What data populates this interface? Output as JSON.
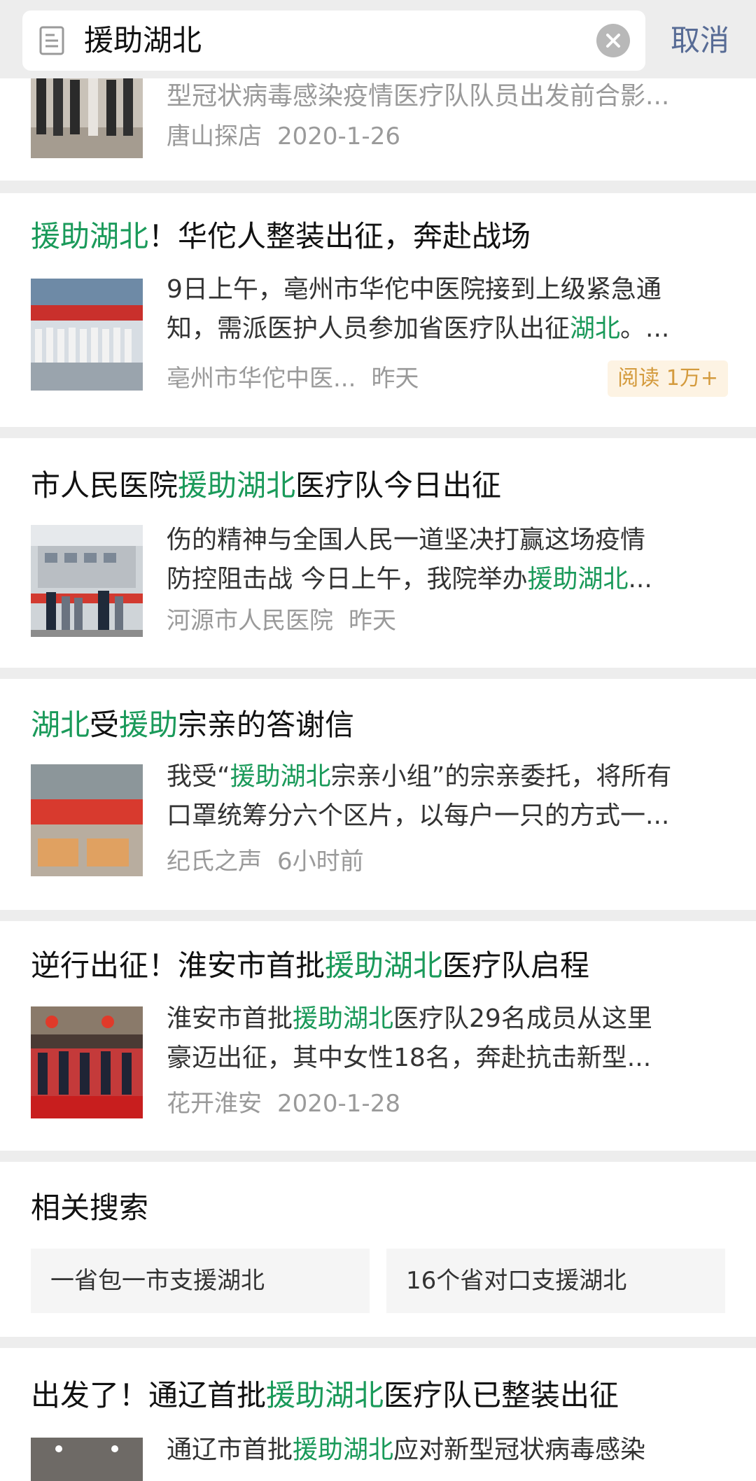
{
  "search": {
    "query": "援助湖北",
    "cancel_label": "取消"
  },
  "results": [
    {
      "snippet_lines": [
        "型冠状病毒感染疫情医疗队队员出发前合影..."
      ],
      "source": "唐山探店",
      "date": "2020-1-26"
    },
    {
      "title": [
        {
          "t": "援助湖北",
          "h": true
        },
        {
          "t": "！华佗人整装出征，奔赴战场",
          "h": false
        }
      ],
      "snippet_lines": [
        [
          {
            "t": "9日上午，亳州市华佗中医院接到上级紧急通",
            "h": false
          }
        ],
        [
          {
            "t": "知，需派医护人员参加省医疗队出征",
            "h": false
          },
          {
            "t": "湖北",
            "h": true
          },
          {
            "t": "。...",
            "h": false
          }
        ]
      ],
      "source": "亳州市华佗中医...",
      "date": "昨天",
      "read_count": "阅读 1万+"
    },
    {
      "title": [
        {
          "t": "市人民医院",
          "h": false
        },
        {
          "t": "援助湖北",
          "h": true
        },
        {
          "t": "医疗队今日出征",
          "h": false
        }
      ],
      "snippet_lines": [
        [
          {
            "t": "伤的精神与全国人民一道坚决打赢这场疫情",
            "h": false
          }
        ],
        [
          {
            "t": "防控阻击战 今日上午，我院举办",
            "h": false
          },
          {
            "t": "援助湖北",
            "h": true
          },
          {
            "t": "...",
            "h": false
          }
        ]
      ],
      "source": "河源市人民医院",
      "date": "昨天"
    },
    {
      "title": [
        {
          "t": "湖北",
          "h": true
        },
        {
          "t": "受",
          "h": false
        },
        {
          "t": "援助",
          "h": true
        },
        {
          "t": "宗亲的答谢信",
          "h": false
        }
      ],
      "snippet_lines": [
        [
          {
            "t": "我受“",
            "h": false
          },
          {
            "t": "援助湖北",
            "h": true
          },
          {
            "t": "宗亲小组”的宗亲委托，将所有",
            "h": false
          }
        ],
        [
          {
            "t": "口罩统筹分六个区片，以每户一只的方式一...",
            "h": false
          }
        ]
      ],
      "source": "纪氏之声",
      "date": "6小时前"
    },
    {
      "title": [
        {
          "t": "逆行出征！淮安市首批",
          "h": false
        },
        {
          "t": "援助湖北",
          "h": true
        },
        {
          "t": "医疗队启程",
          "h": false
        }
      ],
      "snippet_lines": [
        [
          {
            "t": "淮安市首批",
            "h": false
          },
          {
            "t": "援助湖北",
            "h": true
          },
          {
            "t": "医疗队29名成员从这里",
            "h": false
          }
        ],
        [
          {
            "t": "豪迈出征，其中女性18名，奔赴抗击新型...",
            "h": false
          }
        ]
      ],
      "source": "花开淮安",
      "date": "2020-1-28"
    },
    {
      "title": [
        {
          "t": "出发了！通辽首批",
          "h": false
        },
        {
          "t": "援助湖北",
          "h": true
        },
        {
          "t": "医疗队已整装出征",
          "h": false
        }
      ],
      "snippet_lines": [
        [
          {
            "t": "通辽市首批",
            "h": false
          },
          {
            "t": "援助湖北",
            "h": true
          },
          {
            "t": "应对新型冠状病毒感染",
            "h": false
          }
        ]
      ]
    }
  ],
  "related": {
    "title": "相关搜索",
    "items": [
      "一省包一市支援湖北",
      "16个省对口支援湖北"
    ]
  },
  "colors": {
    "highlight": "#1a9a5a",
    "cancel": "#576b95",
    "read_badge_text": "#d49b3e"
  }
}
